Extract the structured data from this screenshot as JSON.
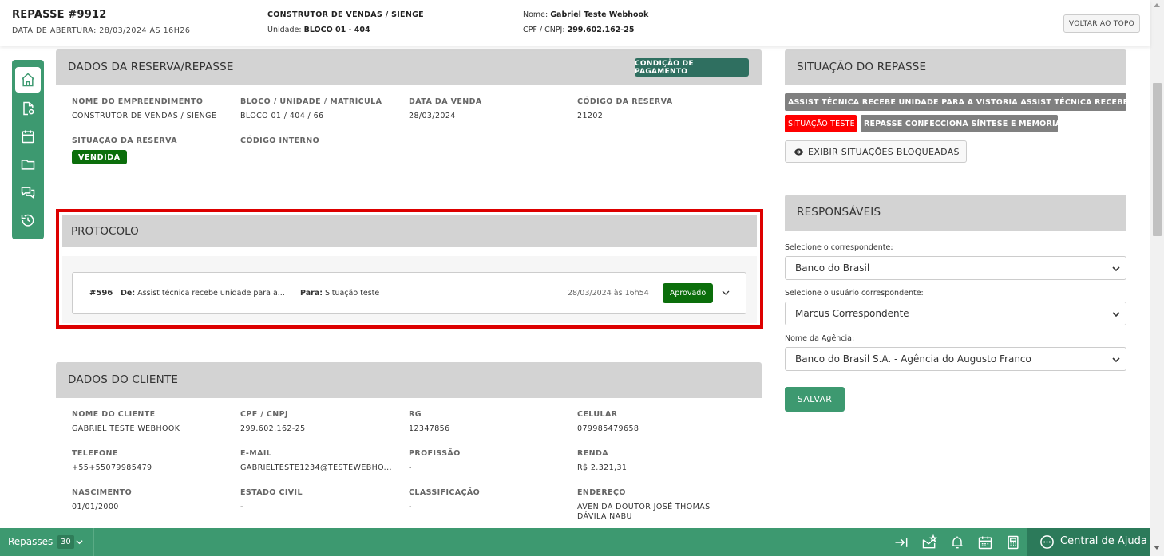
{
  "header": {
    "title": "REPASSE #9912",
    "opening": "DATA DE ABERTURA: 28/03/2024 ÀS 16H26",
    "builder": "CONSTRUTOR DE VENDAS / SIENGE",
    "unit_label": "Unidade:",
    "unit_value": "BLOCO 01 - 404",
    "name_label": "Nome:",
    "name_value": "Gabriel Teste Webhook",
    "cpf_label": "CPF / CNPJ:",
    "cpf_value": "299.602.162-25",
    "back_to_top": "VOLTAR AO TOPO"
  },
  "reserva": {
    "title": "DADOS DA RESERVA/REPASSE",
    "payment_button": "CONDIÇÃO DE PAGAMENTO",
    "fields": [
      {
        "label": "NOME DO EMPREENDIMENTO",
        "value": "CONSTRUTOR DE VENDAS / SIENGE"
      },
      {
        "label": "BLOCO / UNIDADE / MATRÍCULA",
        "value": "BLOCO 01 / 404 / 66"
      },
      {
        "label": "DATA DA VENDA",
        "value": "28/03/2024"
      },
      {
        "label": "CÓDIGO DA RESERVA",
        "value": "21202"
      },
      {
        "label": "SITUAÇÃO DA RESERVA",
        "value": "VENDIDA"
      },
      {
        "label": "CÓDIGO INTERNO",
        "value": ""
      }
    ]
  },
  "protocolo": {
    "title": "PROTOCOLO",
    "number": "#596",
    "from_label": "De:",
    "from_value": "Assist técnica recebe unidade para a...",
    "to_label": "Para:",
    "to_value": "Situação teste",
    "datetime": "28/03/2024 às 16h54",
    "status": "Aprovado"
  },
  "cliente": {
    "title": "DADOS DO CLIENTE",
    "fields": [
      {
        "label": "NOME DO CLIENTE",
        "value": "GABRIEL TESTE WEBHOOK"
      },
      {
        "label": "CPF / CNPJ",
        "value": "299.602.162-25"
      },
      {
        "label": "RG",
        "value": "12347856"
      },
      {
        "label": "CELULAR",
        "value": "079985479658"
      },
      {
        "label": "TELEFONE",
        "value": "+55+55079985479"
      },
      {
        "label": "E-MAIL",
        "value": "GABRIELTESTE1234@TESTEWEBHO..."
      },
      {
        "label": "PROFISSÃO",
        "value": "-"
      },
      {
        "label": "RENDA",
        "value": "R$ 2.321,31"
      },
      {
        "label": "NASCIMENTO",
        "value": "01/01/2000"
      },
      {
        "label": "ESTADO CIVIL",
        "value": "-"
      },
      {
        "label": "CLASSIFICAÇÃO",
        "value": "-"
      },
      {
        "label": "ENDEREÇO",
        "value": "AVENIDA DOUTOR JOSÉ THOMAS DÁVILA NABU"
      }
    ]
  },
  "situacao": {
    "title": "SITUAÇÃO DO REPASSE",
    "badges": [
      {
        "text": "ASSIST TÉCNICA RECEBE UNIDADE PARA A VISTORIA ASSIST TÉCNICA RECEBE ...",
        "color": "#808080"
      },
      {
        "text": "SITUAÇÃO TESTE",
        "color": "#ff0000"
      },
      {
        "text": "REPASSE CONFECCIONA SÍNTESE E MEMORIAL",
        "color": "#808080"
      }
    ],
    "show_blocked": "EXIBIR SITUAÇÕES BLOQUEADAS"
  },
  "responsaveis": {
    "title": "RESPONSÁVEIS",
    "correspondente_label": "Selecione o correspondente:",
    "correspondente_value": "Banco do Brasil",
    "usuario_label": "Selecione o usuário correspondente:",
    "usuario_value": "Marcus Correspondente",
    "agencia_label": "Nome da Agência:",
    "agencia_value": "Banco do Brasil S.A. - Agência do Augusto Franco",
    "save": "SALVAR"
  },
  "bottombar": {
    "label": "Repasses",
    "count": "30",
    "help": "Central de Ajuda"
  },
  "colors": {
    "accent": "#3d9970",
    "approved": "#0b6e0b",
    "highlight_border": "#dd0000"
  }
}
